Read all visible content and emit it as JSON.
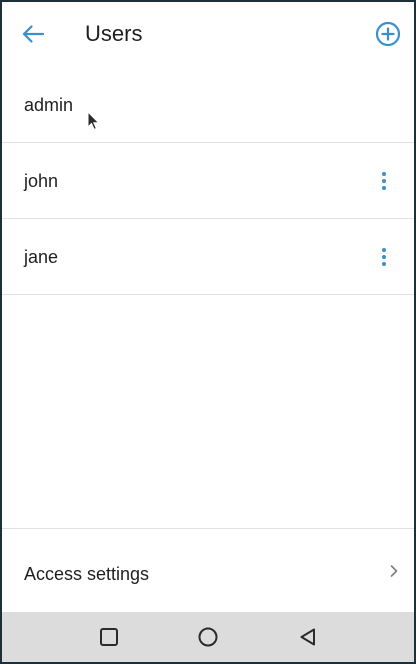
{
  "header": {
    "title": "Users",
    "back_icon": "arrow-left-icon",
    "add_icon": "add-circle-icon"
  },
  "users": [
    {
      "name": "admin",
      "has_menu": false
    },
    {
      "name": "john",
      "has_menu": true
    },
    {
      "name": "jane",
      "has_menu": true
    }
  ],
  "access_settings": {
    "label": "Access settings",
    "icon": "chevron-right-icon"
  },
  "nav_bar": {
    "icons": [
      "recent-apps-icon",
      "home-icon",
      "back-triangle-icon"
    ]
  },
  "colors": {
    "accent": "#3a8fcc",
    "divider": "#e2e2e2",
    "nav_bar": "#dcdcdc"
  }
}
